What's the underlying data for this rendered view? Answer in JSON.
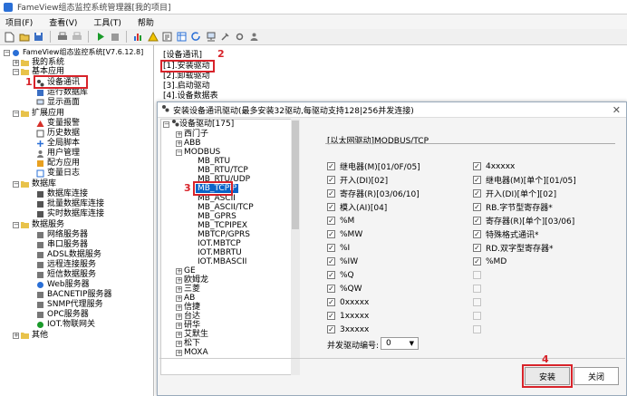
{
  "window": {
    "title": "FameView组态监控系统管理器[我的项目]"
  },
  "menu": [
    "项目(F)",
    "查看(V)",
    "工具(T)",
    "帮助"
  ],
  "left_tree": {
    "root": "FameView组态监控系统[V7.6.12.8]",
    "items": [
      {
        "label": "我的系统"
      },
      {
        "label": "基本应用"
      },
      {
        "label": "设备通讯"
      },
      {
        "label": "运行数据库"
      },
      {
        "label": "显示画面"
      },
      {
        "label": "扩展应用"
      },
      {
        "label": "变量报警"
      },
      {
        "label": "历史数据"
      },
      {
        "label": "全局脚本"
      },
      {
        "label": "用户管理"
      },
      {
        "label": "配方应用"
      },
      {
        "label": "变量日志"
      },
      {
        "label": "数据库"
      },
      {
        "label": "数据库连接"
      },
      {
        "label": "批量数据库连接"
      },
      {
        "label": "实时数据库连接"
      },
      {
        "label": "数据服务"
      },
      {
        "label": "网络服务器"
      },
      {
        "label": "串口服务器"
      },
      {
        "label": "ADSL数据服务"
      },
      {
        "label": "远程连接服务"
      },
      {
        "label": "短信数据服务"
      },
      {
        "label": "Web服务器"
      },
      {
        "label": "BACNETIP服务器"
      },
      {
        "label": "SNMP代理服务"
      },
      {
        "label": "OPC服务器"
      },
      {
        "label": "IOT.物联网关"
      },
      {
        "label": "其他"
      }
    ]
  },
  "right_panel": {
    "header": "[设备通讯]",
    "items": [
      "[1].安装驱动",
      "[2].卸载驱动",
      "[3].启动驱动",
      "[4].设备数据表"
    ]
  },
  "annotations": [
    "1",
    "2",
    "3",
    "4"
  ],
  "dialog": {
    "title": "安装设备通讯驱动(最多安装32驱动,每驱动支持128|256并发连接)",
    "tree_root": "设备驱动[175]",
    "tree_items": [
      "西门子",
      "ABB",
      "MODBUS",
      "MB_RTU",
      "MB_RTU/TCP",
      "MB_RTU/UDP",
      "MB_TCPIP",
      "MB_ASCII",
      "MB_ASCII/TCP",
      "MB_GPRS",
      "MB_TCPIPEX",
      "MBTCP/GPRS",
      "IOT.MBTCP",
      "IOT.MBRTU",
      "IOT.MBASCII",
      "GE",
      "欧姆龙",
      "三菱",
      "AB",
      "信捷",
      "台达",
      "研华",
      "艾默生",
      "松下",
      "MOXA"
    ],
    "protocol": "[以太网驱动]MODBUS/TCP",
    "left_checks": [
      "继电器(M)[01/0F/05]",
      "开入(DI)[02]",
      "寄存器(R)[03/06/10]",
      "模入(AI)[04]",
      "%M",
      "%MW",
      "%I",
      "%IW",
      "%Q",
      "%QW",
      "0xxxxx",
      "1xxxxx",
      "3xxxxx"
    ],
    "right_checks": [
      "4xxxxx",
      "继电器(M)[单个][01/05]",
      "开入(DI)[单个][02]",
      "RB.字节型寄存器*",
      "寄存器(R)[单个][03/06]",
      "特殊格式通讯*",
      "RD.双字型寄存器*",
      "%MD"
    ],
    "concurrency_label": "并发驱动编号:",
    "concurrency_value": "0",
    "install_button": "安装",
    "close_button": "关闭"
  },
  "colors": {
    "annotation": "#d8232a",
    "selection": "#0a64c8"
  }
}
